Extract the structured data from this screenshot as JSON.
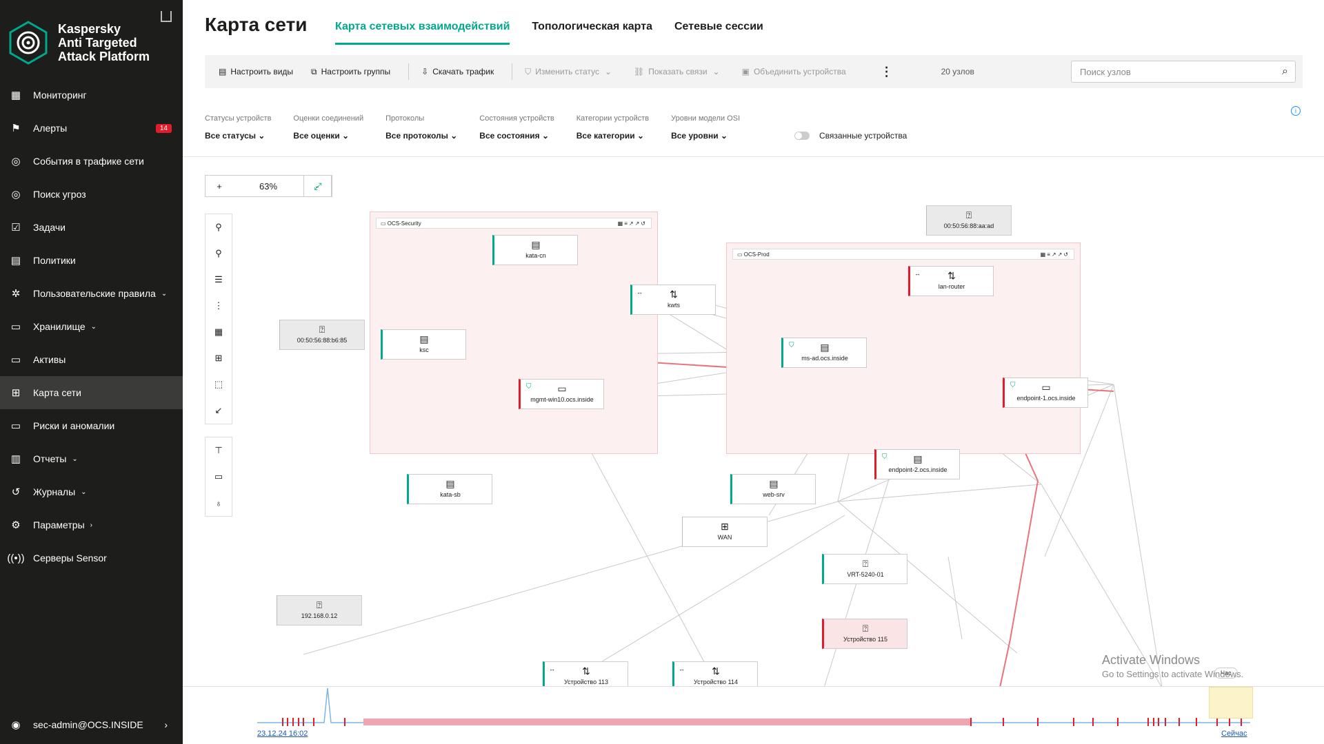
{
  "app": {
    "brand_line1": "Kaspersky",
    "brand_line2": "Anti Targeted",
    "brand_line3": "Attack Platform"
  },
  "nav": [
    {
      "label": "Мониторинг",
      "icon": "dashboard-icon"
    },
    {
      "label": "Алерты",
      "icon": "flag-icon",
      "badge": "14"
    },
    {
      "label": "События в трафике сети",
      "icon": "radar-icon"
    },
    {
      "label": "Поиск угроз",
      "icon": "radar-icon"
    },
    {
      "label": "Задачи",
      "icon": "checkbox-icon"
    },
    {
      "label": "Политики",
      "icon": "document-icon"
    },
    {
      "label": "Пользовательские правила",
      "icon": "gear-icon",
      "chevron": "⌄"
    },
    {
      "label": "Хранилище",
      "icon": "folder-icon",
      "chevron": "⌄"
    },
    {
      "label": "Активы",
      "icon": "monitor-icon"
    },
    {
      "label": "Карта сети",
      "icon": "network-map-icon",
      "active": true
    },
    {
      "label": "Риски и аномалии",
      "icon": "monitor-icon"
    },
    {
      "label": "Отчеты",
      "icon": "report-icon",
      "chevron": "⌄"
    },
    {
      "label": "Журналы",
      "icon": "history-icon",
      "chevron": "⌄"
    },
    {
      "label": "Параметры",
      "icon": "gear-icon",
      "chevron": "›"
    },
    {
      "label": "Серверы Sensor",
      "icon": "sensor-icon"
    }
  ],
  "user": {
    "name": "sec-admin@OCS.INSIDE"
  },
  "page": {
    "title": "Карта сети"
  },
  "tabs": [
    {
      "label": "Карта сетевых взаимодействий",
      "active": true
    },
    {
      "label": "Топологическая карта"
    },
    {
      "label": "Сетевые сессии"
    }
  ],
  "toolbar": {
    "configure_views": "Настроить виды",
    "configure_groups": "Настроить группы",
    "download_traffic": "Скачать трафик",
    "change_status": "Изменить статус",
    "show_links": "Показать связи",
    "merge_devices": "Объединить устройства",
    "node_count": "20 узлов",
    "search_placeholder": "Поиск узлов"
  },
  "filters": [
    {
      "label": "Статусы устройств",
      "value": "Все статусы"
    },
    {
      "label": "Оценки соединений",
      "value": "Все оценки"
    },
    {
      "label": "Протоколы",
      "value": "Все протоколы"
    },
    {
      "label": "Состояния устройств",
      "value": "Все состояния"
    },
    {
      "label": "Категории устройств",
      "value": "Все категории"
    },
    {
      "label": "Уровни модели OSI",
      "value": "Все уровни"
    }
  ],
  "related_toggle": "Связанные устройства",
  "zoom": {
    "plus": "+",
    "minus": "-",
    "level": "63%"
  },
  "groups": {
    "security": "OCS-Security",
    "prod": "OCS-Prod"
  },
  "nodes": {
    "kata_cn": "kata-cn",
    "kwts": "kwts",
    "ksc": "ksc",
    "mgmt": "mgmt-win10.ocs.inside",
    "kata_sb": "kata-sb",
    "mac_aa": "00:50:56:88:aa:ad",
    "mac_b6": "00:50:56:88:b6:85",
    "lan_router": "lan-router",
    "ms_ad": "ms-ad.ocs.inside",
    "endpoint1": "endpoint-1.ocs.inside",
    "endpoint2": "endpoint-2.ocs.inside",
    "web_srv": "web-srv",
    "wan": "WAN",
    "vrt": "VRT-5240-01",
    "dev115": "Устройство 115",
    "ip": "192.168.0.12",
    "dev113": "Устройство 113",
    "dev114": "Устройство 114"
  },
  "timeline": {
    "start": "23.12.24 16:02",
    "end": "Сейчас",
    "period": "Час"
  },
  "watermark": {
    "line1": "Activate Windows",
    "line2": "Go to Settings to activate Windows."
  }
}
